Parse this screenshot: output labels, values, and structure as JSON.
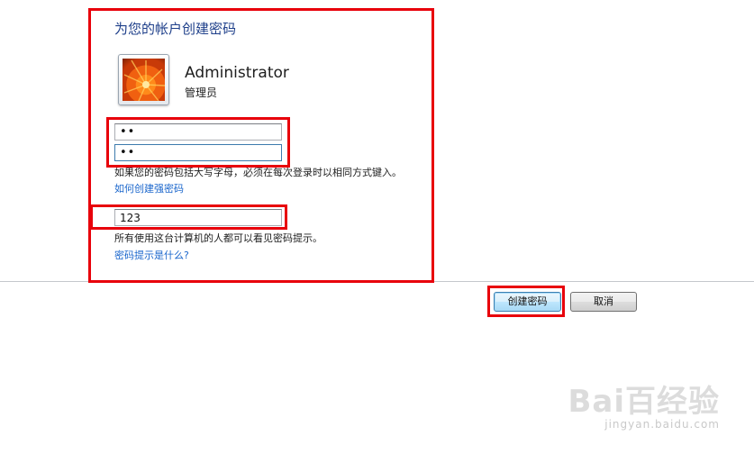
{
  "dialog": {
    "heading": "为您的帐户创建密码",
    "account": {
      "name": "Administrator",
      "role": "管理员",
      "avatar_icon": "orange-flower-picture"
    },
    "password_value": "••",
    "confirm_value": "••",
    "case_note": "如果您的密码包括大写字母，必须在每次登录时以相同方式键入。",
    "strong_password_link": "如何创建强密码",
    "hint_value": "123",
    "hint_note": "所有使用这台计算机的人都可以看见密码提示。",
    "hint_help_link": "密码提示是什么?"
  },
  "buttons": {
    "create": "创建密码",
    "cancel": "取消"
  },
  "watermark": {
    "logo": "Bai百经验",
    "url": "jingyan.baidu.com"
  },
  "colors": {
    "highlight": "#e8000b",
    "heading": "#1e3f8a",
    "link": "#1a66cc"
  }
}
